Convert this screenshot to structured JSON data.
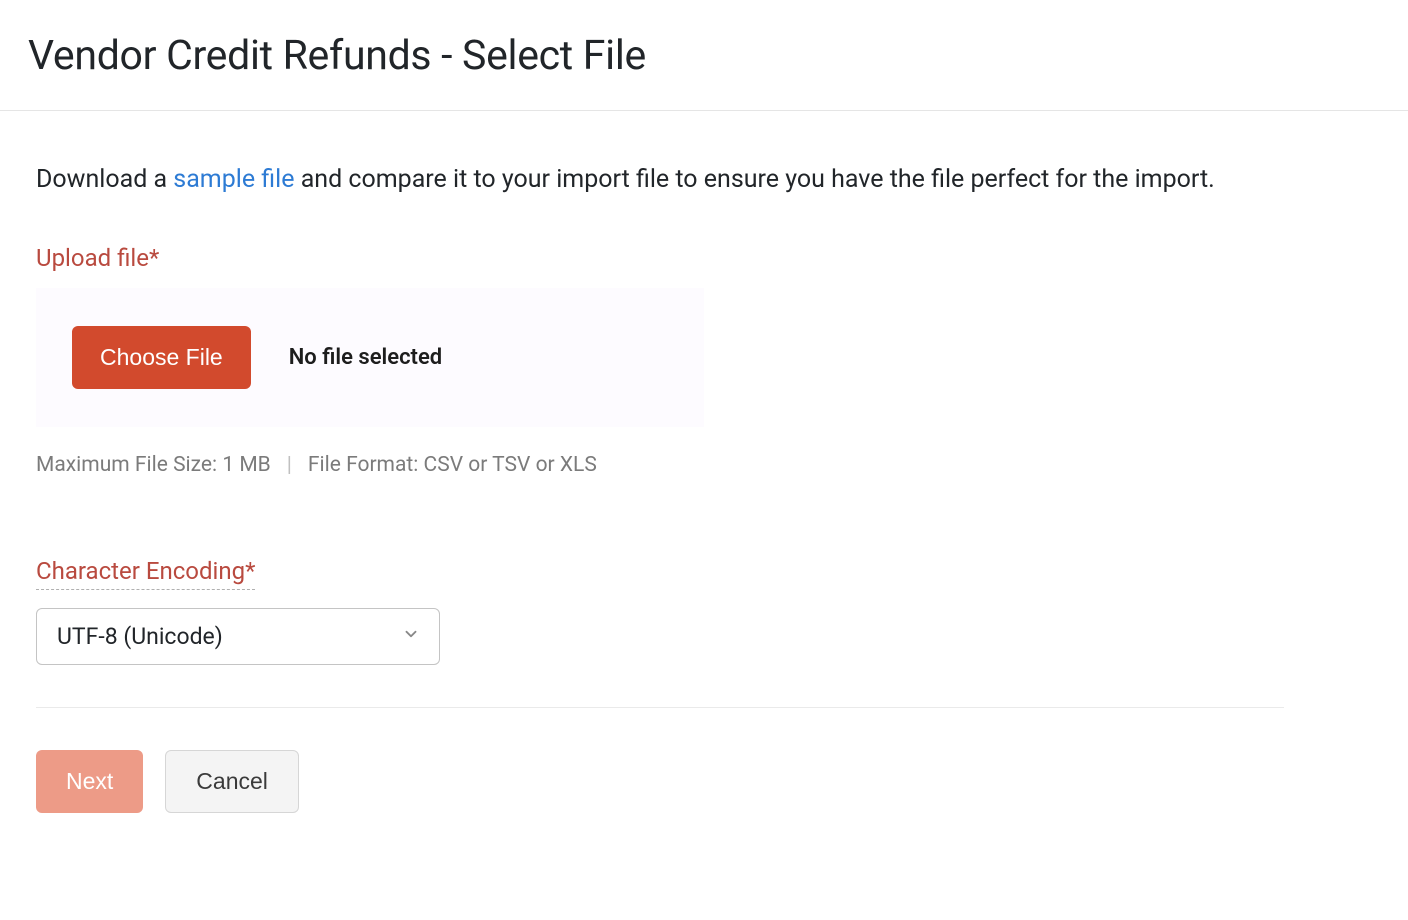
{
  "header": {
    "title": "Vendor Credit Refunds - Select File"
  },
  "helper": {
    "prefix": "Download a ",
    "link_text": "sample file",
    "suffix": " and compare it to your import file to ensure you have the file perfect for the import."
  },
  "upload": {
    "label": "Upload file*",
    "choose_button": "Choose File",
    "no_file_text": "No file selected",
    "max_size": "Maximum File Size: 1 MB",
    "format": "File Format: CSV or TSV or XLS"
  },
  "encoding": {
    "label": "Character Encoding*",
    "selected": "UTF-8 (Unicode)"
  },
  "actions": {
    "next": "Next",
    "cancel": "Cancel"
  }
}
